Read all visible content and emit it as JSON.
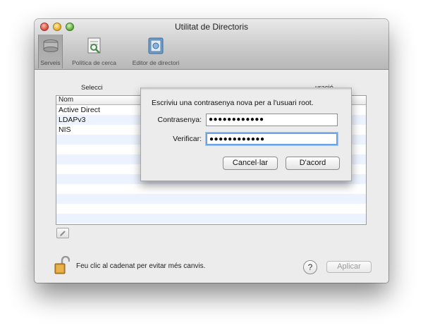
{
  "window": {
    "title": "Utilitat de Directoris"
  },
  "toolbar": {
    "items": [
      {
        "label": "Serveis",
        "icon": "services-icon"
      },
      {
        "label": "Política de cerca",
        "icon": "search-policy-icon"
      },
      {
        "label": "Editor de directori",
        "icon": "directory-editor-icon"
      }
    ]
  },
  "main": {
    "instruction_start": "Selecci",
    "instruction_end": "uració.",
    "table": {
      "header": "Nom",
      "rows": [
        "Active Direct",
        "LDAPv3",
        "NIS"
      ]
    },
    "lock_text": "Feu clic al cadenat per evitar més canvis.",
    "help_label": "?",
    "apply_label": "Aplicar"
  },
  "sheet": {
    "prompt": "Escriviu una contrasenya nova per a l'usuari root.",
    "password_label": "Contrasenya:",
    "password_value": "●●●●●●●●●●●●",
    "verify_label": "Verificar:",
    "verify_value": "●●●●●●●●●●●●",
    "cancel_label": "Cancel·lar",
    "ok_label": "D'acord"
  },
  "colors": {
    "focus": "#6ca4e6",
    "alt_row": "#edf3fe"
  }
}
